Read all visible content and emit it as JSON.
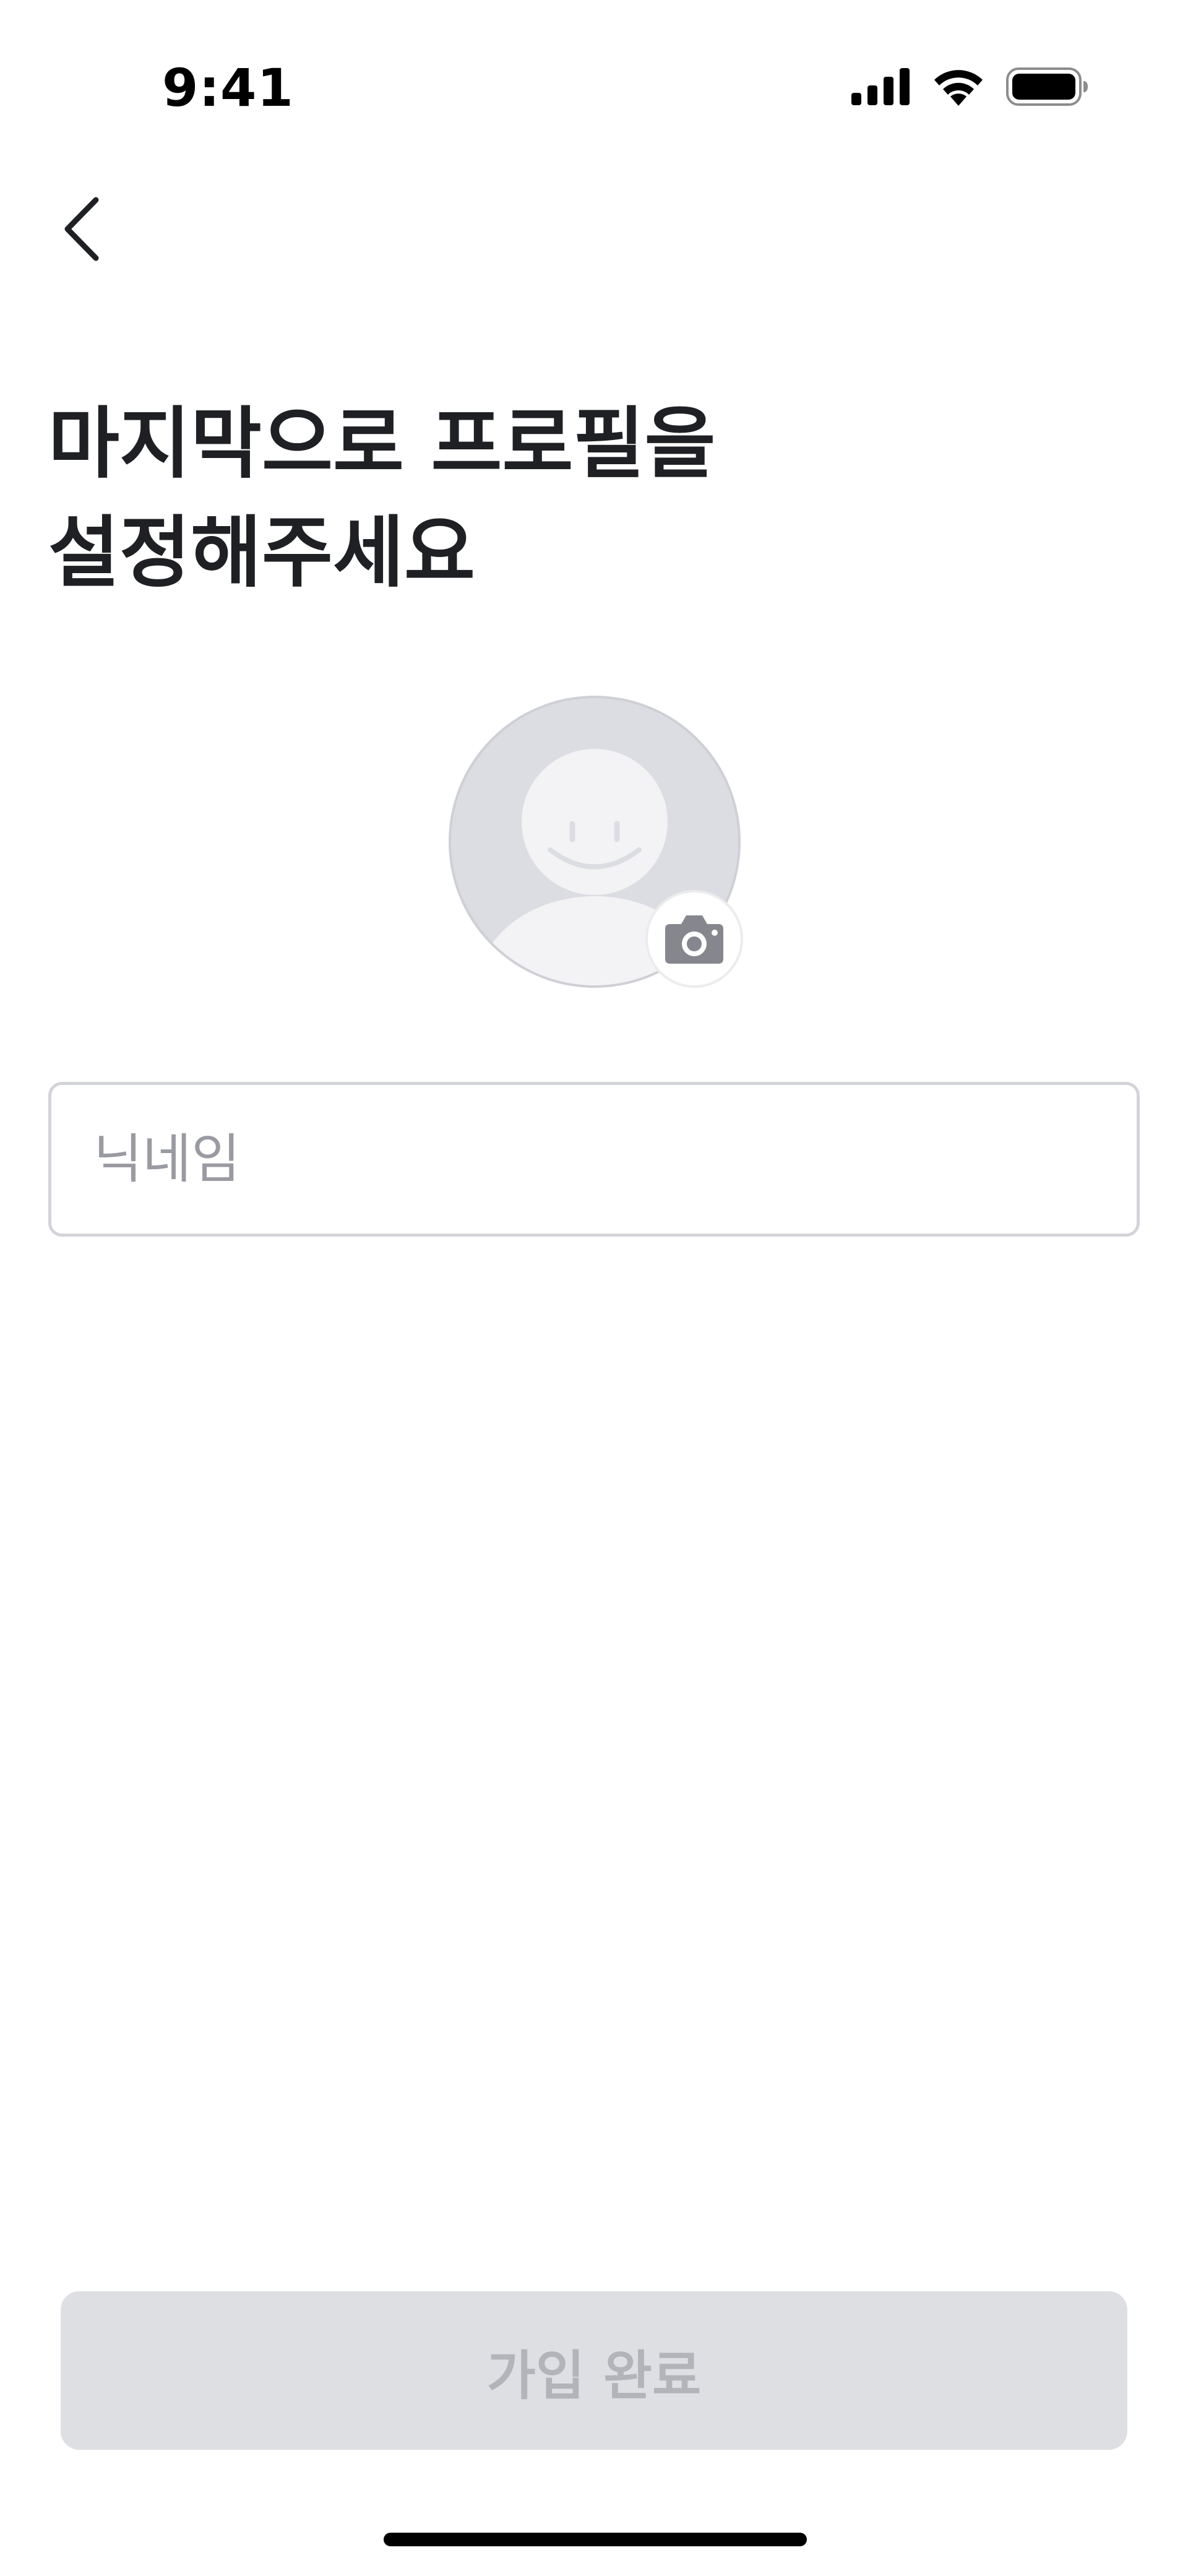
{
  "status_bar": {
    "time": "9:41",
    "icons": [
      "cellular-signal-icon",
      "wifi-icon",
      "battery-icon"
    ]
  },
  "nav": {
    "back_icon": "chevron-left-icon"
  },
  "header": {
    "title_line1": "마지막으로 프로필을",
    "title_line2": "설정해주세요"
  },
  "profile": {
    "avatar_icon": "default-avatar-icon",
    "camera_icon": "camera-icon"
  },
  "form": {
    "nickname_placeholder": "닉네임",
    "nickname_value": ""
  },
  "footer": {
    "submit_label": "가입 완료",
    "submit_enabled": false
  },
  "colors": {
    "title_text": "#1f2024",
    "avatar_bg": "#dcdde2",
    "avatar_figure": "#f3f3f5",
    "camera_icon": "#86878e",
    "input_border": "#d3d4d9",
    "placeholder": "#9a9ba2",
    "button_disabled_bg": "#dedfe3",
    "button_disabled_text": "#b3b4ba"
  }
}
